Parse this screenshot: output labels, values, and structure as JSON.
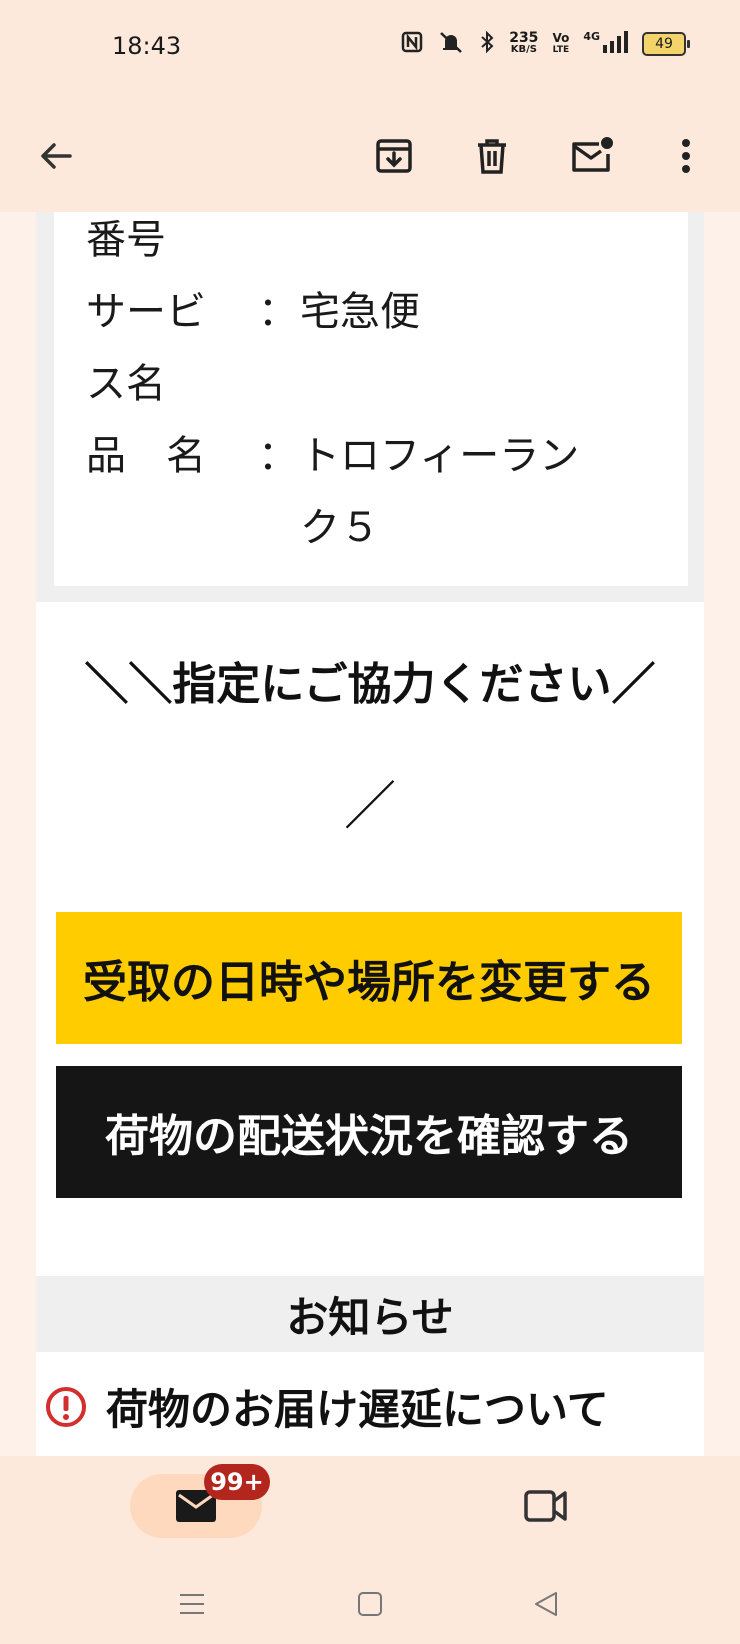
{
  "status_bar": {
    "time": "18:43",
    "net_speed_value": "235",
    "net_speed_unit": "KB/S",
    "volte_top": "Vo",
    "volte_bottom": "LTE",
    "network": "4G",
    "battery": "49"
  },
  "app_bar": {
    "icons": [
      "back-arrow-icon",
      "archive-icon",
      "trash-icon",
      "mark-unread-icon",
      "more-vert-icon"
    ]
  },
  "email": {
    "info_rows": [
      {
        "label": "番号",
        "sep": "",
        "value": ""
      },
      {
        "label": "サービ",
        "sep": "：",
        "value": "宅急便"
      },
      {
        "label": "ス名",
        "sep": "",
        "value": ""
      },
      {
        "label": "品　名",
        "sep": "：",
        "value": "トロフィーラン"
      },
      {
        "label": "",
        "sep": "",
        "value": "ク５"
      }
    ],
    "headline": "＼＼指定にご協力ください／",
    "headline_tail": "／",
    "primary_button": "受取の日時や場所を変更する",
    "secondary_button": "荷物の配送状況を確認する",
    "notice_title": "お知らせ",
    "notice_item": "荷物のお届け遅延について"
  },
  "bottom_nav": {
    "mail_badge": "99+",
    "icons": [
      "mail-icon",
      "video-icon"
    ]
  },
  "colors": {
    "surface": "#fde9dc",
    "yellow": "#ffcc00",
    "black": "#151515",
    "badge": "#b3261e",
    "alert": "#d32f2f"
  }
}
